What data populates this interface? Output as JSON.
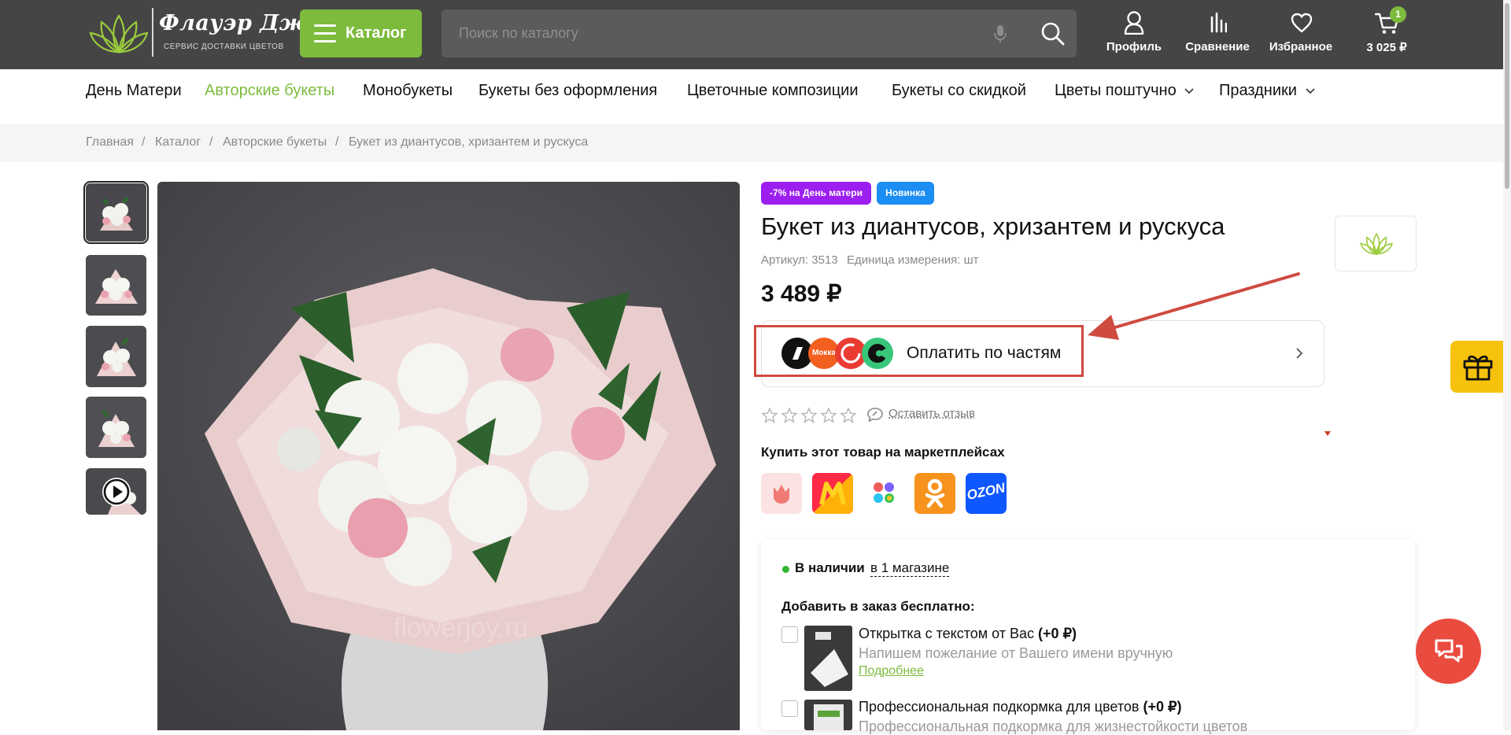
{
  "header": {
    "logo": {
      "name": "Флауэр Джой",
      "tagline": "СЕРВИС ДОСТАВКИ ЦВЕТОВ"
    },
    "catalog_label": "Каталог",
    "search_placeholder": "Поиск по каталогу",
    "profile_label": "Профиль",
    "compare_label": "Сравнение",
    "favorites_label": "Избранное",
    "cart_total": "3 025 ₽",
    "cart_count": "1"
  },
  "nav": {
    "items": [
      {
        "label": "День Матери",
        "active": false
      },
      {
        "label": "Авторские букеты",
        "active": true
      },
      {
        "label": "Монобукеты",
        "active": false
      },
      {
        "label": "Букеты без оформления",
        "active": false
      },
      {
        "label": "Цветочные композиции",
        "active": false
      },
      {
        "label": "Букеты со скидкой",
        "active": false
      },
      {
        "label": "Цветы поштучно",
        "active": false,
        "dropdown": true
      },
      {
        "label": "Праздники",
        "active": false,
        "dropdown": true
      }
    ]
  },
  "breadcrumb": [
    "Главная",
    "Каталог",
    "Авторские букеты",
    "Букет из диантусов, хризантем и рускуса"
  ],
  "product": {
    "badges": [
      {
        "label": "-7% на День матери",
        "color": "#9c1ff0"
      },
      {
        "label": "Новинка",
        "color": "#1c8df2"
      }
    ],
    "title": "Букет из диантусов, хризантем и рускуса",
    "article": "Артикул: 3513",
    "unit": "Единица измерения: шт",
    "price": "3 489 ₽",
    "split_label": "Оплатить по частям",
    "split_logo_text": "Мокка",
    "rating_stars": 0,
    "review_label": "Оставить отзыв",
    "watermark": "flowerjoy.ru",
    "marketplaces_title": "Купить этот товар на маркетплейсах",
    "marketplaces": [
      "flowwow-icon",
      "megamarket-icon",
      "sber-icon",
      "odnoklassniki-icon",
      "ozon-icon"
    ],
    "ozon_label": "OZON"
  },
  "order": {
    "stock_label": "В наличии",
    "stock_link": "в 1 магазине",
    "addons_title": "Добавить в заказ бесплатно:",
    "addons": [
      {
        "title": "Открытка с текстом от Вас",
        "price": "(+0 ₽)",
        "desc": "Напишем пожелание от Вашего имени вручную",
        "more": "Подробнее",
        "checked": false
      },
      {
        "title": "Профессиональная подкормка для цветов",
        "price": "(+0 ₽)",
        "desc": "Профессиональная подкормка для жизнестойкости цветов",
        "checked": false
      }
    ]
  },
  "colors": {
    "accent": "#7dbb3c",
    "header": "#454545",
    "annotation": "#cf4a3f",
    "chat": "#ea4b3f",
    "gift": "#f6c20c"
  }
}
